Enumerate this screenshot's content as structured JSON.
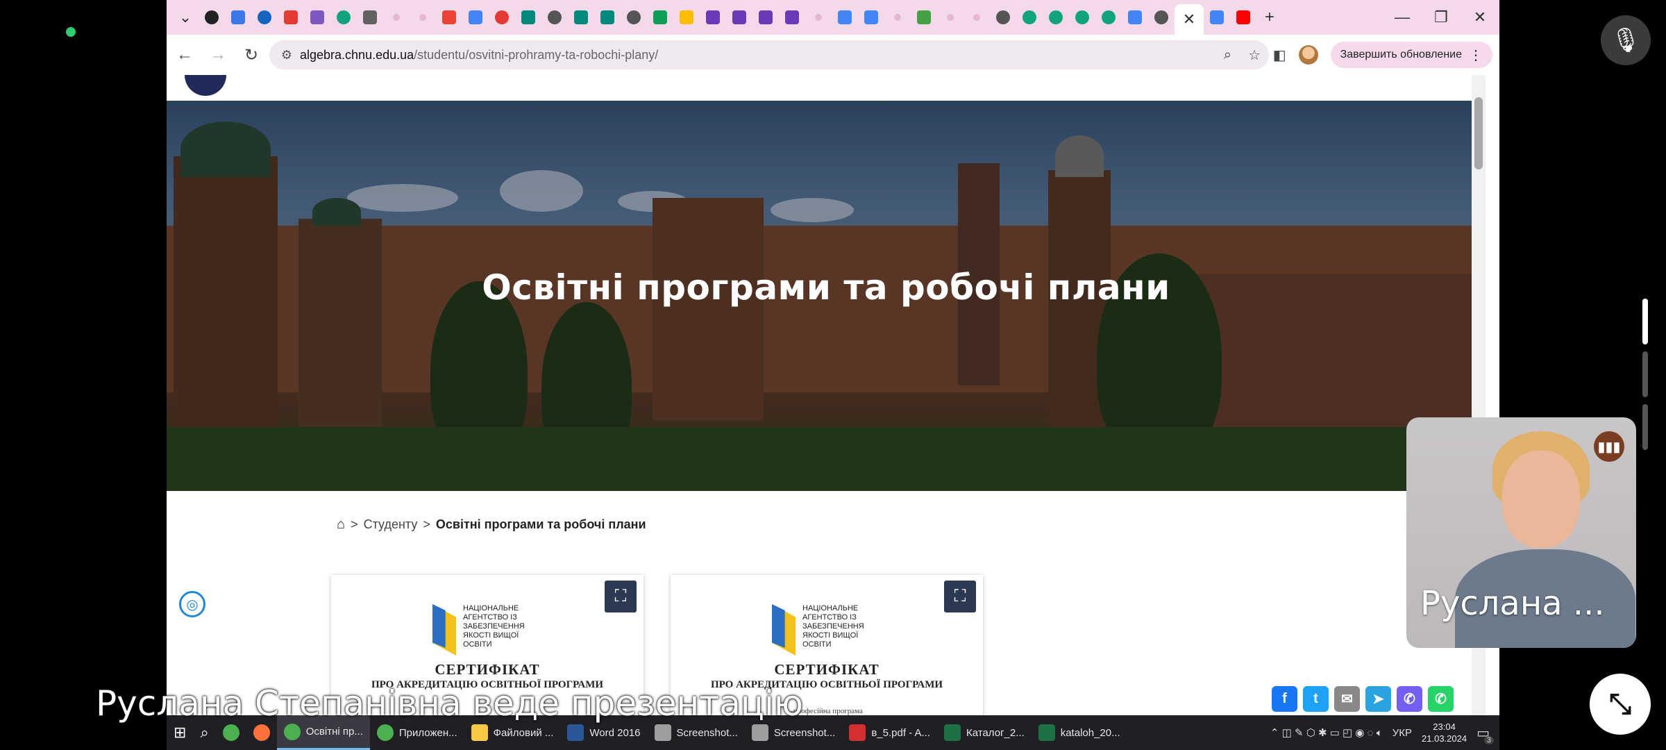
{
  "browser": {
    "tabs": [
      {
        "icon": "chevron-down-icon",
        "color": "#333333"
      },
      {
        "icon": "pl-icon",
        "color": "#222222"
      },
      {
        "icon": "calc-icon",
        "color": "#3b78e7"
      },
      {
        "icon": "globe-icon",
        "color": "#1565c0"
      },
      {
        "icon": "heart-icon",
        "color": "#e53935"
      },
      {
        "icon": "pen-icon",
        "color": "#7e57c2"
      },
      {
        "icon": "chatgpt-icon",
        "color": "#10a37f"
      },
      {
        "icon": "doc-icon",
        "color": "#616161"
      },
      {
        "icon": "dot-icon",
        "color": "#e6b8cf"
      },
      {
        "icon": "dot-icon",
        "color": "#e6b8cf"
      },
      {
        "icon": "gmail-icon",
        "color": "#ea4335"
      },
      {
        "icon": "calendar-icon",
        "color": "#4285f4"
      },
      {
        "icon": "record-icon",
        "color": "#e53935"
      },
      {
        "icon": "meet-icon",
        "color": "#00897b"
      },
      {
        "icon": "globe-icon",
        "color": "#555555"
      },
      {
        "icon": "meet-icon",
        "color": "#00897b"
      },
      {
        "icon": "meet-icon",
        "color": "#00897b"
      },
      {
        "icon": "globe-icon",
        "color": "#555555"
      },
      {
        "icon": "sheets-icon",
        "color": "#0f9d58"
      },
      {
        "icon": "drive-icon",
        "color": "#fbbc04"
      },
      {
        "icon": "forms-icon",
        "color": "#673ab7"
      },
      {
        "icon": "forms-icon",
        "color": "#673ab7"
      },
      {
        "icon": "forms-icon",
        "color": "#673ab7"
      },
      {
        "icon": "forms-icon",
        "color": "#673ab7"
      },
      {
        "icon": "dot-icon",
        "color": "#e6b8cf"
      },
      {
        "icon": "docs-icon",
        "color": "#4285f4"
      },
      {
        "icon": "docs-icon",
        "color": "#4285f4"
      },
      {
        "icon": "dot-icon",
        "color": "#e6b8cf"
      },
      {
        "icon": "frog-icon",
        "color": "#43a047"
      },
      {
        "icon": "dot-icon",
        "color": "#e6b8cf"
      },
      {
        "icon": "dot-icon",
        "color": "#e6b8cf"
      },
      {
        "icon": "globe-icon",
        "color": "#555555"
      },
      {
        "icon": "chatgpt-icon",
        "color": "#10a37f"
      },
      {
        "icon": "chatgpt-icon",
        "color": "#10a37f"
      },
      {
        "icon": "chatgpt-icon",
        "color": "#10a37f"
      },
      {
        "icon": "chatgpt-icon",
        "color": "#10a37f"
      },
      {
        "icon": "google-icon",
        "color": "#4285f4"
      },
      {
        "icon": "globe-icon",
        "color": "#555555"
      }
    ],
    "active_tab": {
      "icon": "close-icon"
    },
    "after_tabs": [
      {
        "icon": "docs-icon",
        "color": "#4285f4"
      },
      {
        "icon": "youtube-icon",
        "color": "#ff0000"
      }
    ],
    "new_tab": "+",
    "window": {
      "minimize": "—",
      "restore": "❐",
      "close": "✕"
    },
    "nav": {
      "back": "←",
      "forward": "→",
      "reload": "↻"
    },
    "url_host": "algebra.chnu.edu.ua",
    "url_path": "/studentu/osvitni-prohramy-ta-robochi-plany/",
    "zoom_icon": "⌕",
    "bookmark_icon": "☆",
    "update_label": "Завершить обновление",
    "menu_icon": "⋮"
  },
  "page": {
    "hero_title": "Освітні програми та робочі плани",
    "breadcrumb": {
      "home_icon": "⌂",
      "sep": ">",
      "item1": "Студенту",
      "current": "Освітні програми та робочі плани"
    },
    "cards": [
      {
        "agency": "НАЦІОНАЛЬНЕ АГЕНТСТВО ІЗ ЗАБЕЗПЕЧЕННЯ ЯКОСТІ ВИЩОЇ ОСВІТИ",
        "title": "СЕРТИФІКАТ",
        "subtitle": "ПРО АКРЕДИТАЦІЮ ОСВІТНЬОЇ ПРОГРАМИ",
        "line": ""
      },
      {
        "agency": "НАЦІОНАЛЬНЕ АГЕНТСТВО ІЗ ЗАБЕЗПЕЧЕННЯ ЯКОСТІ ВИЩОЇ ОСВІТИ",
        "title": "СЕРТИФІКАТ",
        "subtitle": "ПРО АКРЕДИТАЦІЮ ОСВІТНЬОЇ ПРОГРАМИ",
        "line": "-професійна програма"
      }
    ],
    "share": [
      {
        "icon": "facebook-icon",
        "glyph": "f",
        "color": "#1877f2"
      },
      {
        "icon": "twitter-icon",
        "glyph": "t",
        "color": "#1da1f2"
      },
      {
        "icon": "email-icon",
        "glyph": "✉",
        "color": "#888888"
      },
      {
        "icon": "telegram-icon",
        "glyph": "➤",
        "color": "#2aa3df"
      },
      {
        "icon": "viber-icon",
        "glyph": "✆",
        "color": "#7360f2"
      },
      {
        "icon": "whatsapp-icon",
        "glyph": "✆",
        "color": "#25d366"
      }
    ]
  },
  "taskbar": {
    "items": [
      {
        "name": "chrome",
        "label": "",
        "color": "#4caf50"
      },
      {
        "name": "firefox",
        "label": "",
        "color": "#ff7139"
      },
      {
        "name": "chrome-osvitni",
        "label": "Освітні пр...",
        "color": "#4caf50",
        "active": true
      },
      {
        "name": "chrome-prylozhen",
        "label": "Приложен...",
        "color": "#4caf50"
      },
      {
        "name": "explorer",
        "label": "Файловий ...",
        "color": "#f6c945"
      },
      {
        "name": "word",
        "label": "Word 2016",
        "color": "#2b579a"
      },
      {
        "name": "screenshot-1",
        "label": "Screenshot...",
        "color": "#9e9e9e"
      },
      {
        "name": "screenshot-2",
        "label": "Screenshot...",
        "color": "#9e9e9e"
      },
      {
        "name": "pdf",
        "label": "в_5.pdf - A...",
        "color": "#d32f2f"
      },
      {
        "name": "excel-katalog",
        "label": "Каталог_2...",
        "color": "#1e7145"
      },
      {
        "name": "excel-kataloh",
        "label": "kataloh_20...",
        "color": "#1e7145"
      }
    ],
    "lang": "УКР",
    "time": "23:04",
    "date": "21.03.2024",
    "notif_count": "3"
  },
  "call": {
    "presenter_name": "Руслана ...",
    "caption": "Руслана Степанівна веде презентацію"
  }
}
